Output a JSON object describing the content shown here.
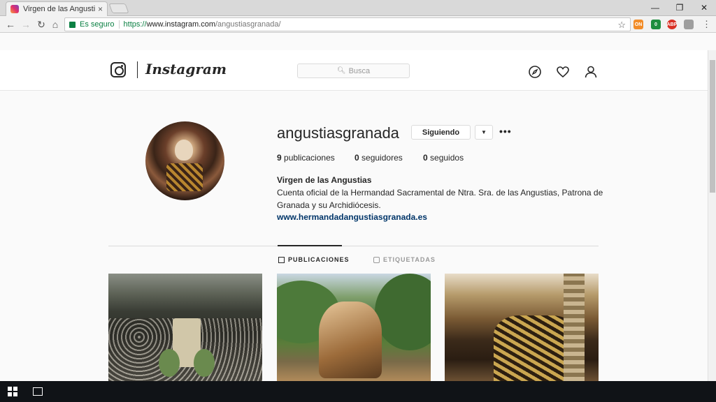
{
  "browser": {
    "tab_title": "Virgen de las Angustias (",
    "tab_close": "×",
    "secure_label": "Es seguro",
    "url_scheme": "https://",
    "url_host": "www.instagram.com",
    "url_path": "/angustiasgranada/"
  },
  "extensions": [
    {
      "name": "extension-orange",
      "color": "#f28c28",
      "label": "ON"
    },
    {
      "name": "extension-green",
      "color": "#1e8e3e",
      "label": "0"
    },
    {
      "name": "extension-adblock",
      "color": "#d93025",
      "label": "ABP"
    },
    {
      "name": "extension-gray",
      "color": "#9e9e9e",
      "label": ""
    }
  ],
  "instagram": {
    "wordmark": "Instagram",
    "search_placeholder": "Busca"
  },
  "profile": {
    "username": "angustiasgranada",
    "following_button": "Siguiendo",
    "dropdown_glyph": "▼",
    "more_glyph": "•••",
    "posts_count": "9",
    "posts_label": "publicaciones",
    "followers_count": "0",
    "followers_label": "seguidores",
    "following_count": "0",
    "following_label": "seguidos",
    "full_name": "Virgen de las Angustias",
    "bio": "Cuenta oficial de la Hermandad Sacramental de Ntra. Sra. de las Angustias, Patrona de Granada y su Archidiócesis.",
    "website": "www.hermandadangustiasgranada.es"
  },
  "tabs": [
    {
      "label": "PUBLICACIONES",
      "active": true
    },
    {
      "label": "ETIQUETADAS",
      "active": false
    }
  ],
  "posts": [
    {
      "description": "procession-crowd-street"
    },
    {
      "description": "virgin-statue-among-trees"
    },
    {
      "description": "gilded-altar-interior"
    }
  ]
}
